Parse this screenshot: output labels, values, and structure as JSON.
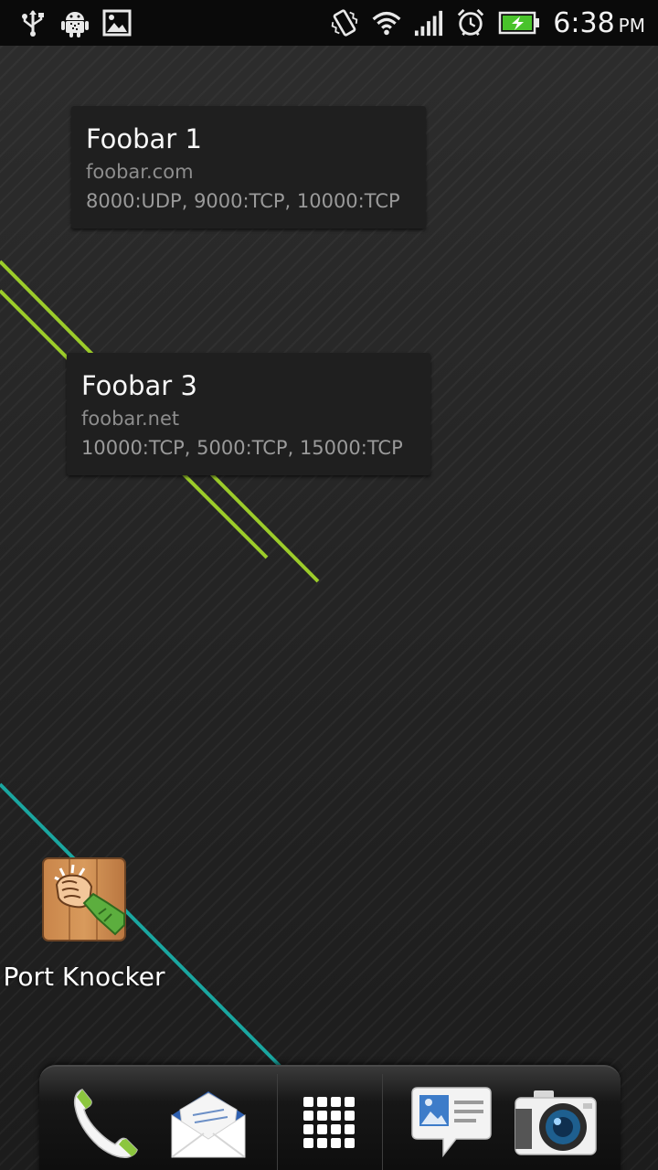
{
  "status_bar": {
    "left_icons": [
      "usb-icon",
      "android-debug-icon",
      "gallery-notification-icon"
    ],
    "right_icons": [
      "vibrate-icon",
      "wifi-icon",
      "signal-icon",
      "alarm-icon",
      "battery-charging-icon"
    ],
    "time": "6:38",
    "ampm": "PM"
  },
  "widgets": [
    {
      "title": "Foobar 1",
      "host": "foobar.com",
      "ports": "8000:UDP, 9000:TCP, 10000:TCP"
    },
    {
      "title": "Foobar 3",
      "host": "foobar.net",
      "ports": "10000:TCP, 5000:TCP, 15000:TCP"
    }
  ],
  "apps": [
    {
      "label": "Port Knocker",
      "icon": "knocking-fist-icon"
    }
  ],
  "dock": {
    "items": [
      "phone-icon",
      "mail-icon",
      "app-drawer-icon",
      "messages-icon",
      "camera-icon"
    ]
  },
  "colors": {
    "wallpaper_green": "#9ccc2a",
    "wallpaper_teal": "#1aa6a0",
    "battery_green": "#49c32b"
  }
}
